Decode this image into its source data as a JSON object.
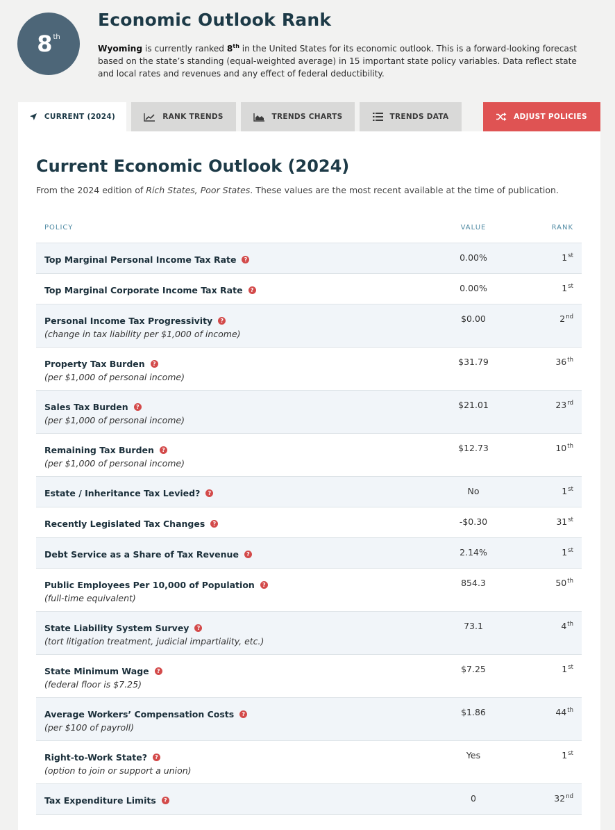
{
  "header": {
    "rank_number": "8",
    "rank_suffix": "th",
    "title": "Economic Outlook Rank",
    "state": "Wyoming",
    "desc_pre": " is currently ranked ",
    "desc_rank": "8",
    "desc_rank_suffix": "th",
    "desc_post": " in the United States for its economic outlook. This is a forward-looking forecast based on the state’s standing (equal-weighted average) in 15 important state policy variables. Data reflect state and local rates and revenues and any effect of federal deductibility."
  },
  "tabs": {
    "current": {
      "label": "Current (2024)",
      "icon": "navigation-arrow-icon"
    },
    "rank_trends": {
      "label": "Rank Trends",
      "icon": "line-chart-icon"
    },
    "trends_charts": {
      "label": "Trends Charts",
      "icon": "area-chart-icon"
    },
    "trends_data": {
      "label": "Trends Data",
      "icon": "list-icon"
    },
    "adjust": {
      "label": "Adjust Policies",
      "icon": "shuffle-icon"
    }
  },
  "colors": {
    "badge": "#4d6678",
    "accent_red": "#df5353",
    "heading": "#1d3a47",
    "column_header": "#4f8aa3"
  },
  "section": {
    "title": "Current Economic Outlook (2024)",
    "sub_pre": "From the 2024 edition of ",
    "sub_italic": "Rich States, Poor States",
    "sub_post": ". These values are the most recent available at the time of publication."
  },
  "table": {
    "headers": {
      "policy": "Policy",
      "value": "Value",
      "rank": "Rank"
    },
    "rows": [
      {
        "label": "Top Marginal Personal Income Tax Rate",
        "sub": "",
        "value": "0.00%",
        "rank": "1",
        "suffix": "st"
      },
      {
        "label": "Top Marginal Corporate Income Tax Rate",
        "sub": "",
        "value": "0.00%",
        "rank": "1",
        "suffix": "st"
      },
      {
        "label": "Personal Income Tax Progressivity",
        "sub": "(change in tax liability per $1,000 of income)",
        "value": "$0.00",
        "rank": "2",
        "suffix": "nd"
      },
      {
        "label": "Property Tax Burden",
        "sub": "(per $1,000 of personal income)",
        "value": "$31.79",
        "rank": "36",
        "suffix": "th"
      },
      {
        "label": "Sales Tax Burden",
        "sub": "(per $1,000 of personal income)",
        "value": "$21.01",
        "rank": "23",
        "suffix": "rd"
      },
      {
        "label": "Remaining Tax Burden",
        "sub": "(per $1,000 of personal income)",
        "value": "$12.73",
        "rank": "10",
        "suffix": "th"
      },
      {
        "label": "Estate / Inheritance Tax Levied?",
        "sub": "",
        "value": "No",
        "rank": "1",
        "suffix": "st"
      },
      {
        "label": "Recently Legislated Tax Changes",
        "sub": "",
        "value": "-$0.30",
        "rank": "31",
        "suffix": "st"
      },
      {
        "label": "Debt Service as a Share of Tax Revenue",
        "sub": "",
        "value": "2.14%",
        "rank": "1",
        "suffix": "st"
      },
      {
        "label": "Public Employees Per 10,000 of Population",
        "sub": "(full-time equivalent)",
        "value": "854.3",
        "rank": "50",
        "suffix": "th"
      },
      {
        "label": "State Liability System Survey",
        "sub": "(tort litigation treatment, judicial impartiality, etc.)",
        "value": "73.1",
        "rank": "4",
        "suffix": "th"
      },
      {
        "label": "State Minimum Wage",
        "sub": "(federal floor is $7.25)",
        "value": "$7.25",
        "rank": "1",
        "suffix": "st"
      },
      {
        "label": "Average Workers’ Compensation Costs",
        "sub": "(per $100 of payroll)",
        "value": "$1.86",
        "rank": "44",
        "suffix": "th"
      },
      {
        "label": "Right-to-Work State?",
        "sub": "(option to join or support a union)",
        "value": "Yes",
        "rank": "1",
        "suffix": "st"
      },
      {
        "label": "Tax Expenditure Limits",
        "sub": "",
        "value": "0",
        "rank": "32",
        "suffix": "nd"
      }
    ]
  }
}
